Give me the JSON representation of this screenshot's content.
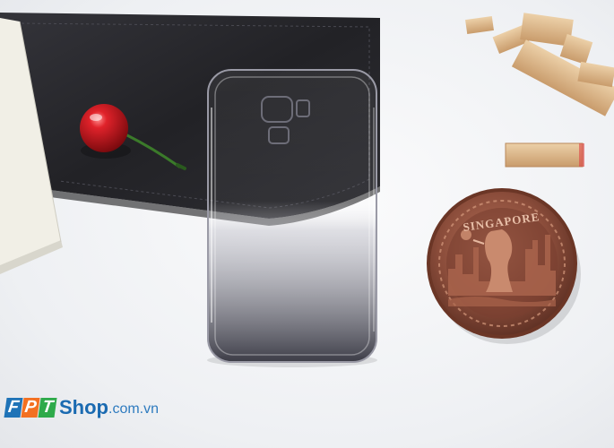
{
  "logo": {
    "letters": [
      "F",
      "P",
      "T"
    ],
    "letter_colors": [
      "#1f73b7",
      "#f37021",
      "#2eaa4a"
    ],
    "shop_text": "Shop",
    "domain_text": ".com.vn"
  },
  "coin": {
    "inscription": "SINGAPORE"
  },
  "palette": {
    "leather": "#2a2a2e",
    "copper": "#8a4c3a",
    "cherry": "#c8141c",
    "wood": "#d9b48a"
  }
}
